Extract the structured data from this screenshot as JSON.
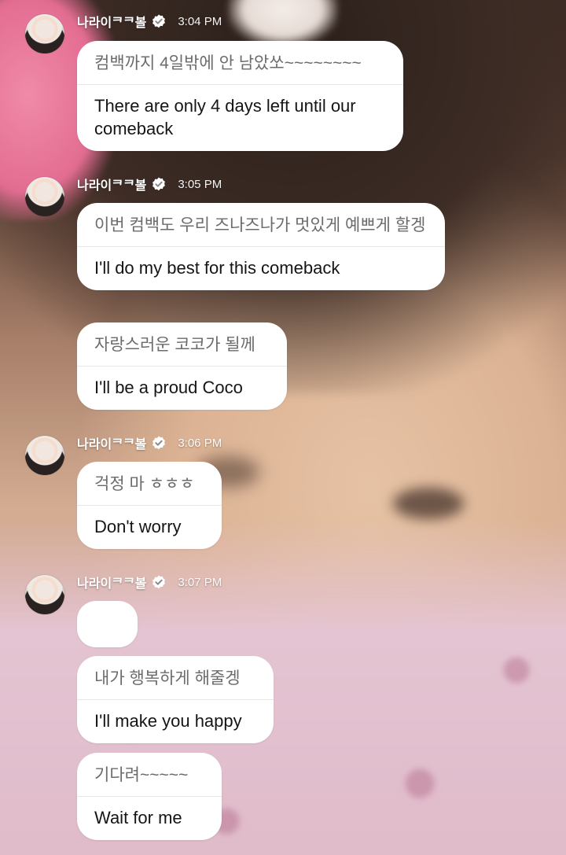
{
  "colors": {
    "bubble_bg": "#ffffff",
    "korean_text": "#6b6b6b",
    "english_text": "#151515",
    "header_text": "#ffffff"
  },
  "messages": [
    {
      "sender": "나라이ᄏᄏ볼",
      "time": "3:04 PM",
      "original": "컴백까지 4일밖에 안 남았쏘~~~~~~~~",
      "translation": "There are only 4 days left until our comeback"
    },
    {
      "sender": "나라이ᄏᄏ볼",
      "time": "3:05 PM",
      "original": "이번 컴백도 우리 즈나즈나가 멋있게 예쁘게 할겡",
      "translation": "I'll do my best for this comeback"
    },
    {
      "original": "자랑스러운 코코가 될께",
      "translation": "I'll be a proud Coco"
    },
    {
      "sender": "나라이ᄏᄏ볼",
      "time": "3:06 PM",
      "original": "걱정 마 ㅎㅎㅎ",
      "translation": "Don't worry"
    },
    {
      "sender": "나라이ᄏᄏ볼",
      "time": "3:07 PM"
    },
    {
      "original": "내가 행복하게 해줄겡",
      "translation": "I'll make you happy"
    },
    {
      "original": "기다려~~~~~",
      "translation": "Wait for me"
    }
  ],
  "icons": {
    "verified": "verified-badge-icon",
    "avatar": "profile-avatar"
  }
}
